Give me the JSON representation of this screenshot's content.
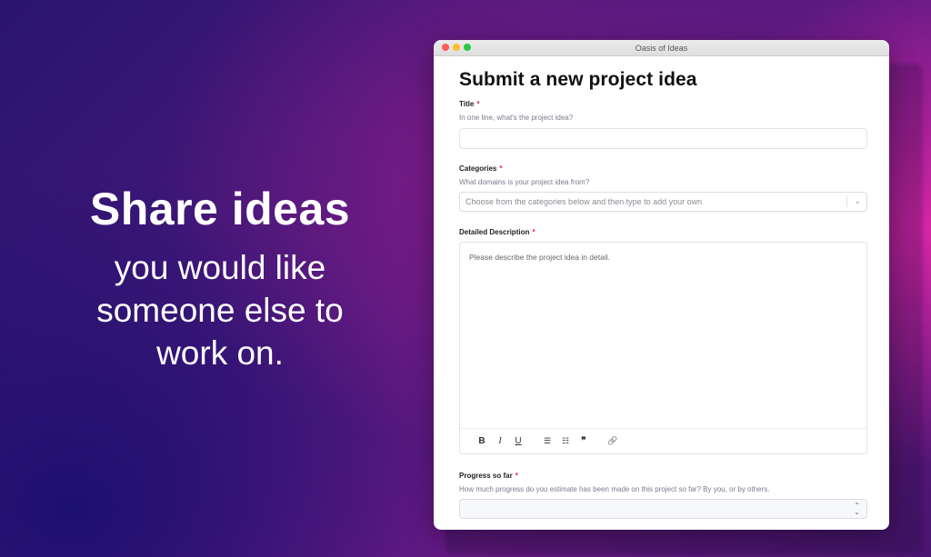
{
  "hero": {
    "title": "Share ideas",
    "subtitle": "you would like someone else to work on."
  },
  "window": {
    "title": "Oasis of Ideas"
  },
  "form": {
    "heading": "Submit a new project idea",
    "title_field": {
      "label": "Title",
      "required_mark": "*",
      "help": "In one line, what's the project idea?",
      "value": ""
    },
    "categories_field": {
      "label": "Categories",
      "required_mark": "*",
      "help": "What domains is your project idea from?",
      "placeholder": "Choose from the categories below and then type to add your own",
      "icon": "chevron-down-icon"
    },
    "description_field": {
      "label": "Detailed Description",
      "required_mark": "*",
      "placeholder": "Please describe the project idea in detail.",
      "toolbar": {
        "bold": "B",
        "italic": "I",
        "underline": "U",
        "bullet_list": "☰",
        "numbered_list": "☷",
        "quote": "❞",
        "link": "🔗"
      }
    },
    "progress_field": {
      "label": "Progress so far",
      "required_mark": "*",
      "help": "How much progress do you estimate has been made on this project so far? By you, or by others.",
      "value": ""
    }
  },
  "colors": {
    "required": "#e0245e",
    "traffic_red": "#fe5f57",
    "traffic_yellow": "#febc2e",
    "traffic_green": "#28c840"
  }
}
